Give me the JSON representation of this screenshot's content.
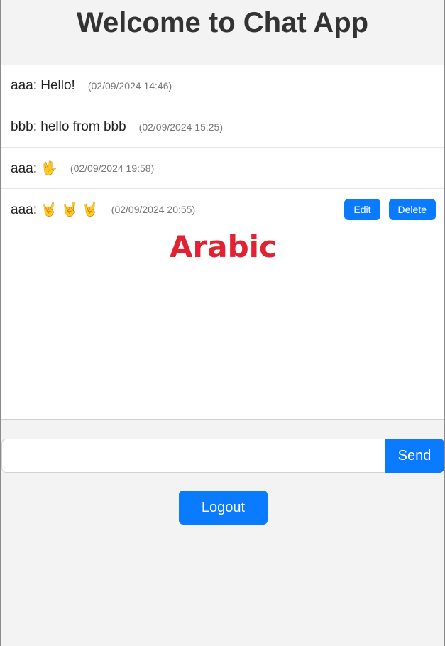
{
  "header": {
    "title": "Welcome to Chat App"
  },
  "messages": [
    {
      "text": "aaa: Hello!",
      "time": "(02/09/2024 14:46)"
    },
    {
      "text": "bbb: hello from bbb",
      "time": "(02/09/2024 15:25)"
    },
    {
      "text": "aaa: 🖖",
      "time": "(02/09/2024 19:58)"
    },
    {
      "text": "aaa: 🤘 🤘 🤘",
      "time": "(02/09/2024 20:55)",
      "actions": {
        "edit": "Edit",
        "delete": "Delete"
      }
    }
  ],
  "overlay": {
    "label": "Arabic",
    "color": "#e02232"
  },
  "composer": {
    "input_value": "",
    "input_placeholder": "",
    "send_label": "Send"
  },
  "footer": {
    "logout_label": "Logout"
  },
  "colors": {
    "accent": "#0a7bff",
    "background": "#f3f3f3"
  }
}
